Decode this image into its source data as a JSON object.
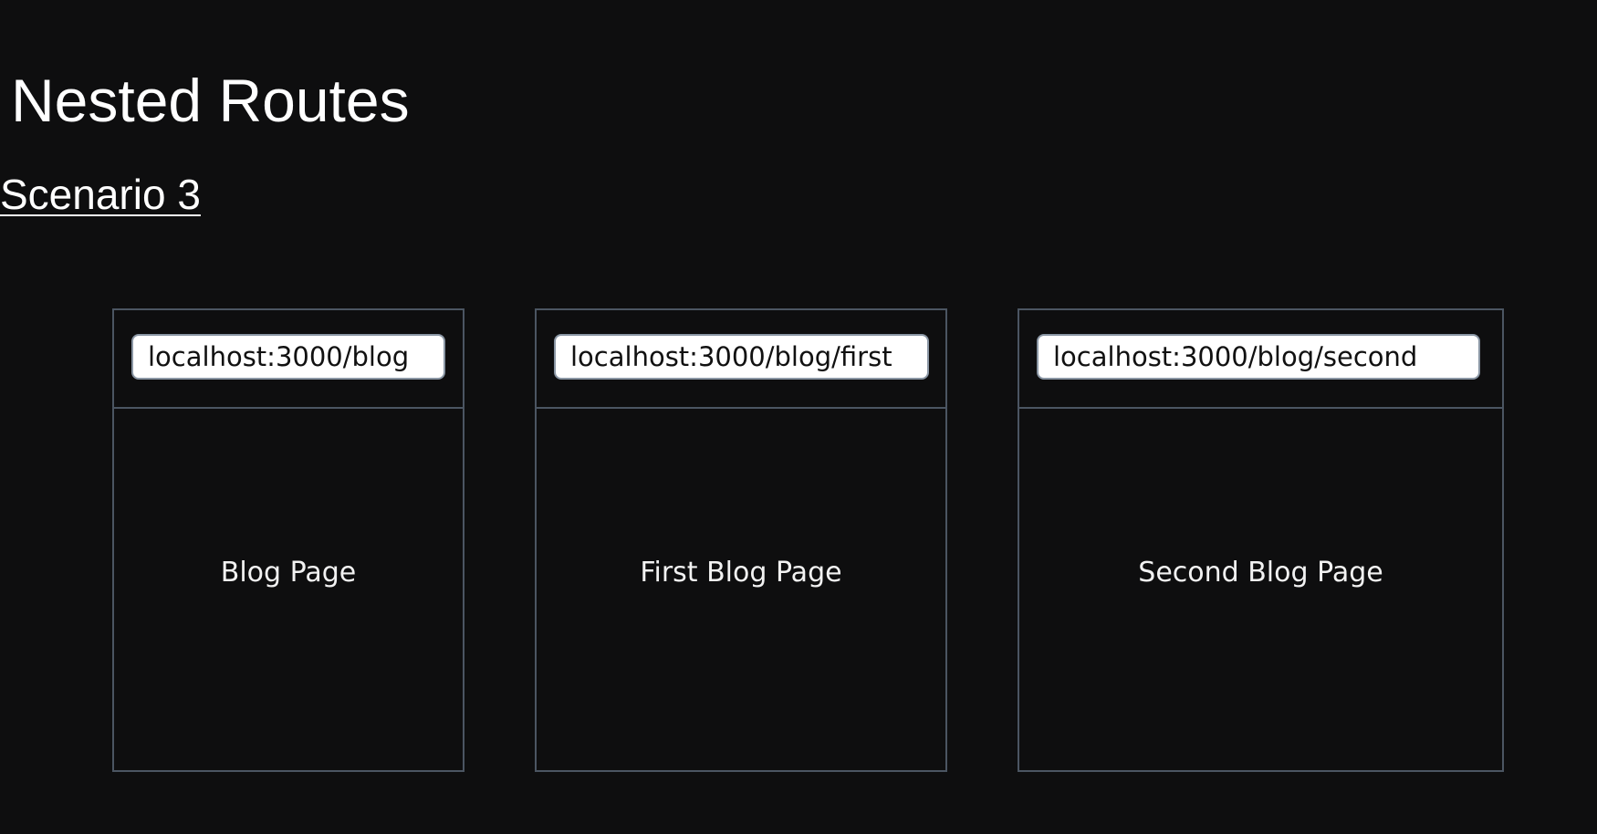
{
  "title": "Nested Routes",
  "subtitle": "Scenario 3",
  "frames": [
    {
      "url": "localhost:3000/blog",
      "content": "Blog Page"
    },
    {
      "url": "localhost:3000/blog/first",
      "content": "First Blog Page"
    },
    {
      "url": "localhost:3000/blog/second",
      "content": "Second Blog Page"
    }
  ]
}
